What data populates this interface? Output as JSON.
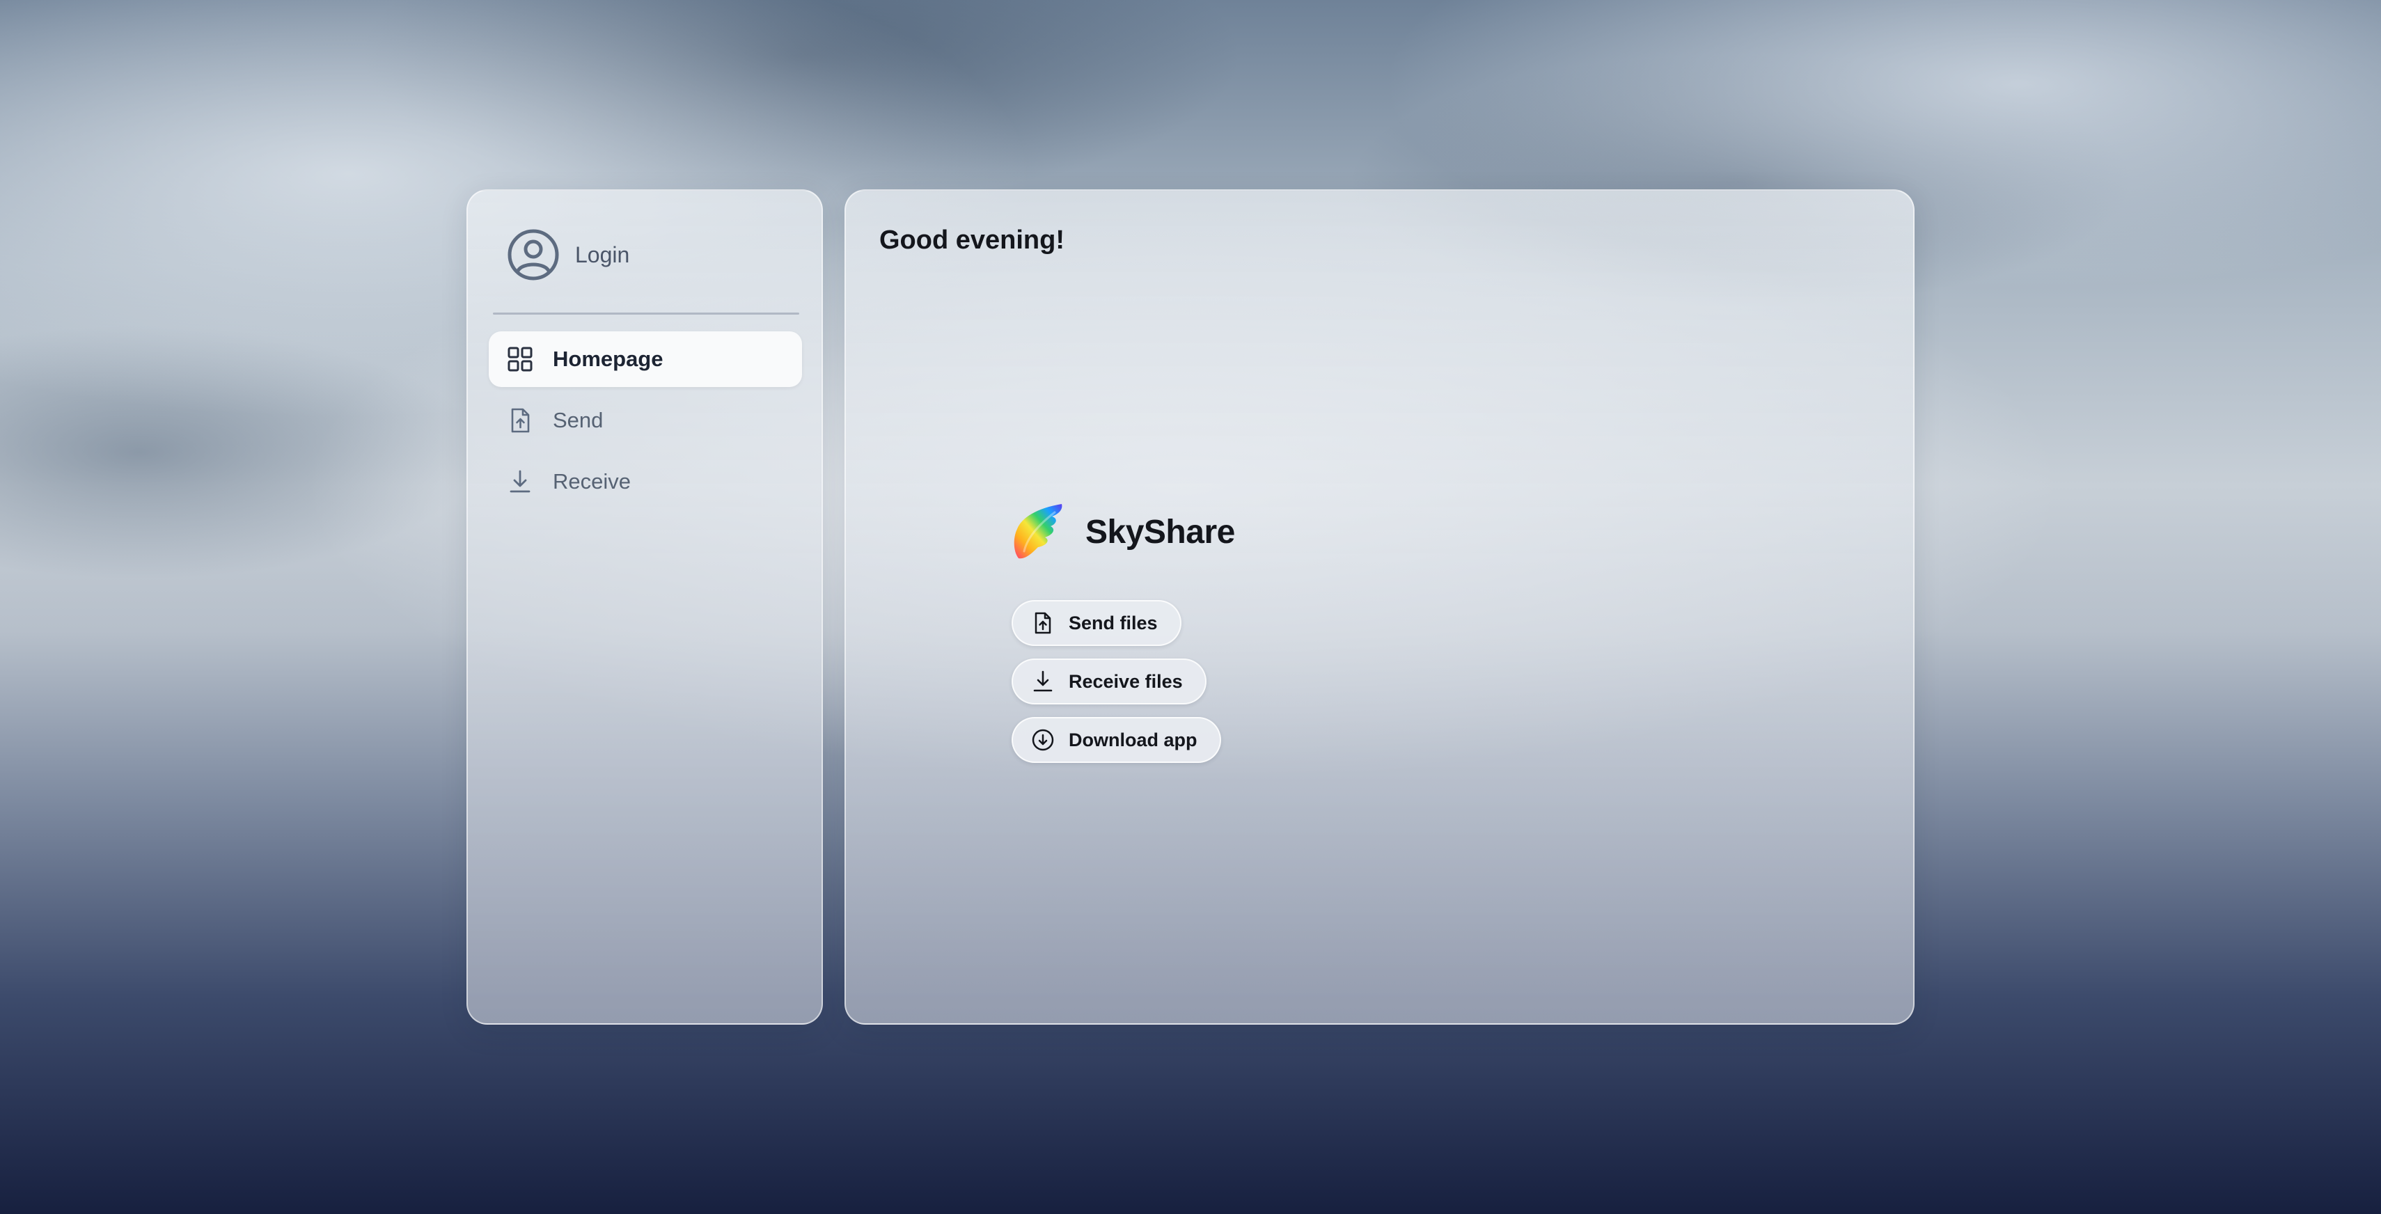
{
  "sidebar": {
    "login_label": "Login",
    "items": [
      {
        "label": "Homepage",
        "icon": "grid-icon",
        "active": true
      },
      {
        "label": "Send",
        "icon": "file-upload-icon",
        "active": false
      },
      {
        "label": "Receive",
        "icon": "download-icon",
        "active": false
      }
    ]
  },
  "main": {
    "greeting": "Good evening!",
    "brand_name": "SkyShare",
    "actions": [
      {
        "label": "Send files",
        "icon": "file-upload-icon"
      },
      {
        "label": "Receive files",
        "icon": "download-icon"
      },
      {
        "label": "Download app",
        "icon": "circle-download-icon"
      }
    ]
  },
  "colors": {
    "text_primary": "#14161c",
    "text_secondary": "#566273",
    "active_item_bg": "#ffffff"
  }
}
